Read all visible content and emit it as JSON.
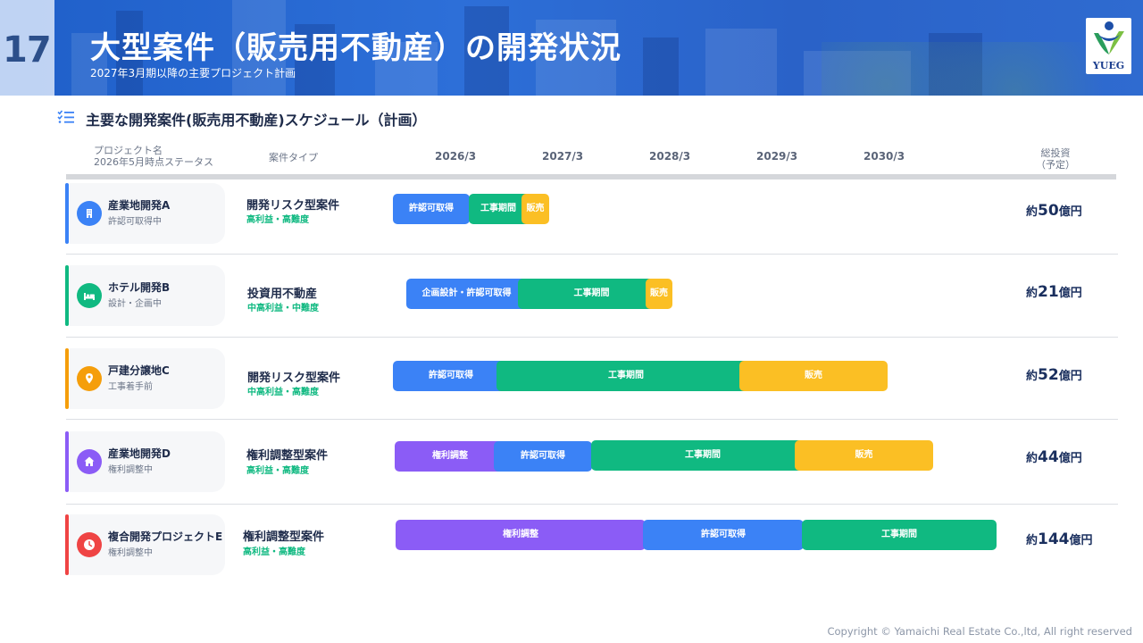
{
  "header": {
    "page_number": "17",
    "title": "大型案件（販売用不動産）の開発状況",
    "subtitle": "2027年3月期以降の主要プロジェクト計画",
    "logo_text": "YUEG"
  },
  "section": {
    "title": "主要な開発案件(販売用不動産)スケジュール（計画）",
    "icon": "checklist-icon"
  },
  "columns": {
    "project_name": "プロジェクト名",
    "status_note": "2026年5月時点ステータス",
    "type": "案件タイプ",
    "years": [
      "2026/3",
      "2027/3",
      "2028/3",
      "2029/3",
      "2030/3"
    ],
    "investment": "総投資",
    "investment_note": "（予定）"
  },
  "colors": {
    "approve": "#3b82f6",
    "construct": "#10b981",
    "sale": "#fbbf24",
    "adjust": "#8b5cf6",
    "project_a": "#3b82f6",
    "project_b": "#10b981",
    "project_c": "#f59e0b",
    "project_d": "#8b5cf6",
    "project_e": "#ef4444"
  },
  "projects": [
    {
      "name": "産業地開発A",
      "status": "許認可取得中",
      "icon": "building-icon",
      "type": "開発リスク型案件",
      "profile": "高利益・高難度",
      "phases": [
        {
          "label": "許認可取得",
          "kind": "approve"
        },
        {
          "label": "工事期間",
          "kind": "construct"
        },
        {
          "label": "販売",
          "kind": "sale"
        }
      ],
      "invest_prefix": "約",
      "invest_value": "50",
      "invest_unit": "億円"
    },
    {
      "name": "ホテル開発B",
      "status": "設計・企画中",
      "icon": "hotel-bed-icon",
      "type": "投資用不動産",
      "profile": "中高利益・中難度",
      "phases": [
        {
          "label": "企画設計・許認可取得",
          "kind": "approve"
        },
        {
          "label": "工事期間",
          "kind": "construct"
        },
        {
          "label": "販売",
          "kind": "sale"
        }
      ],
      "invest_prefix": "約",
      "invest_value": "21",
      "invest_unit": "億円"
    },
    {
      "name": "戸建分譲地C",
      "status": "工事着手前",
      "icon": "map-pin-icon",
      "type": "開発リスク型案件",
      "profile": "中高利益・高難度",
      "phases": [
        {
          "label": "許認可取得",
          "kind": "approve"
        },
        {
          "label": "工事期間",
          "kind": "construct"
        },
        {
          "label": "販売",
          "kind": "sale"
        }
      ],
      "invest_prefix": "約",
      "invest_value": "52",
      "invest_unit": "億円"
    },
    {
      "name": "産業地開発D",
      "status": "権利調整中",
      "icon": "home-icon",
      "type": "権利調整型案件",
      "profile": "高利益・高難度",
      "phases": [
        {
          "label": "権利調整",
          "kind": "adjust"
        },
        {
          "label": "許認可取得",
          "kind": "approve"
        },
        {
          "label": "工事期間",
          "kind": "construct"
        },
        {
          "label": "販売",
          "kind": "sale"
        }
      ],
      "invest_prefix": "約",
      "invest_value": "44",
      "invest_unit": "億円"
    },
    {
      "name": "複合開発プロジェクトE",
      "status": "権利調整中",
      "icon": "clock-icon",
      "type": "権利調整型案件",
      "profile": "高利益・高難度",
      "phases": [
        {
          "label": "権利調整",
          "kind": "adjust"
        },
        {
          "label": "許認可取得",
          "kind": "approve"
        },
        {
          "label": "工事期間",
          "kind": "construct"
        }
      ],
      "invest_prefix": "約",
      "invest_value": "144",
      "invest_unit": "億円"
    }
  ],
  "footer": {
    "copyright": "Copyright © Yamaichi Real Estate Co.,ltd, All right reserved"
  }
}
